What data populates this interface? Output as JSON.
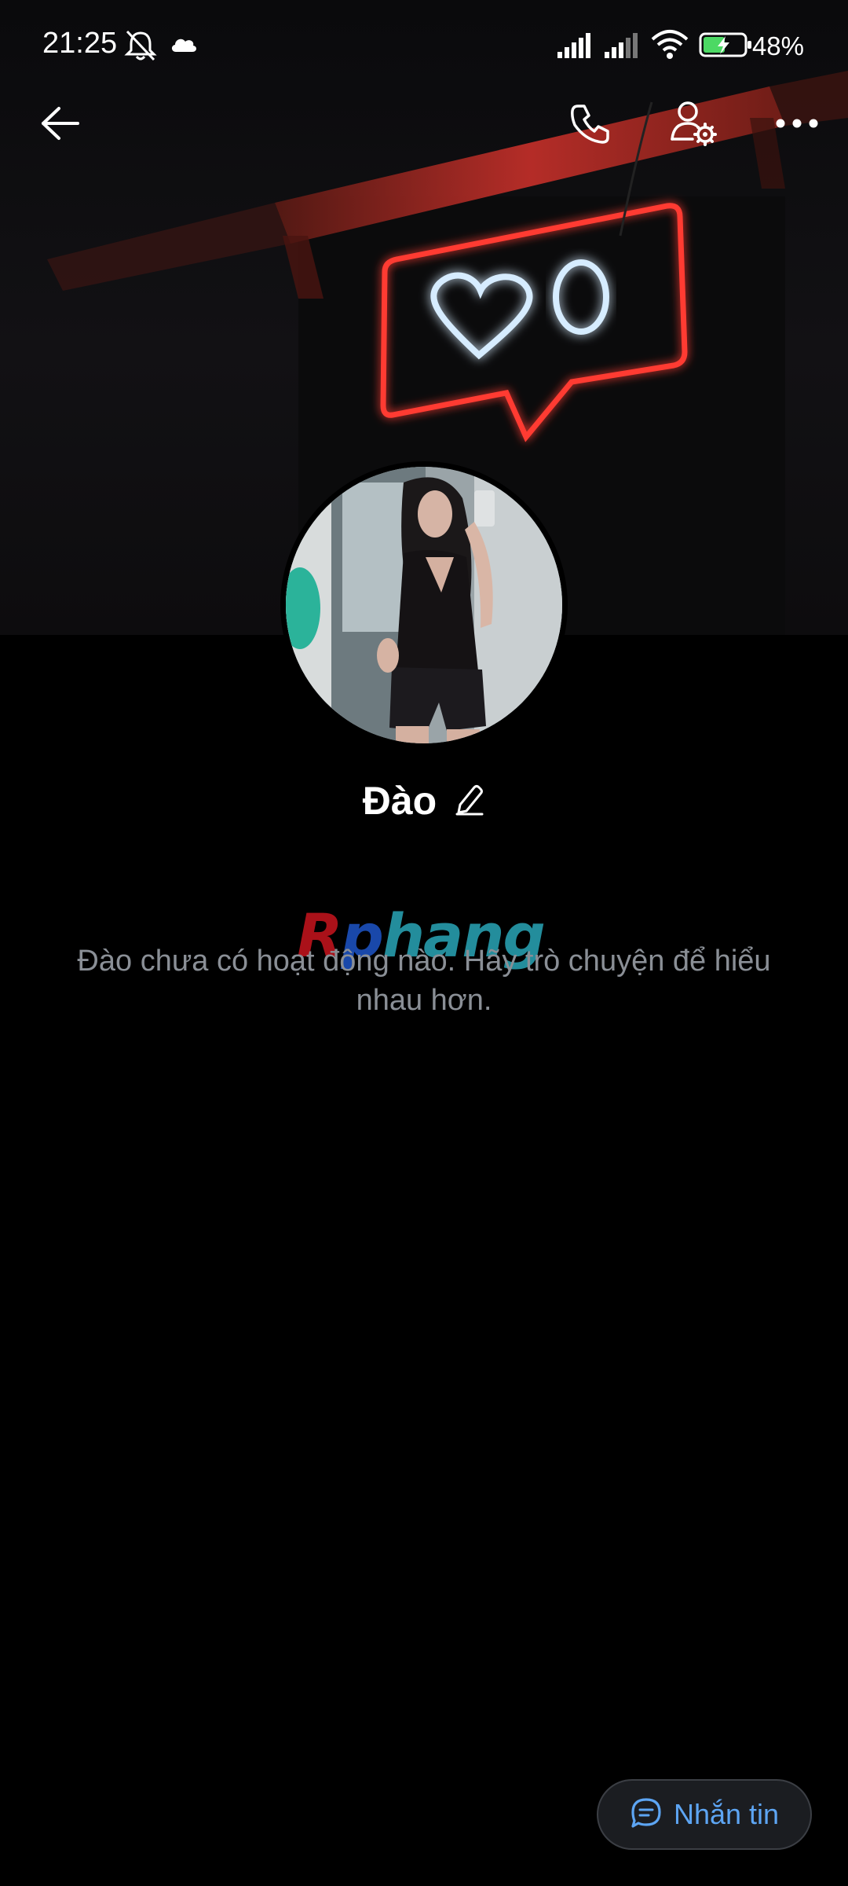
{
  "status_bar": {
    "time": "21:25",
    "battery": "48%",
    "icons": [
      "mute-notification-icon",
      "cloud-icon",
      "signal-1-icon",
      "signal-2-icon",
      "wifi-icon",
      "battery-charging-icon"
    ]
  },
  "app_bar": {
    "icons": [
      "back-arrow-icon",
      "phone-icon",
      "user-settings-icon",
      "more-icon"
    ]
  },
  "profile": {
    "name": "Đào",
    "edit_icon": "pencil-icon"
  },
  "watermark": {
    "part1": "R",
    "part2": "p",
    "part3": "hang"
  },
  "empty_state": {
    "message": "Đào chưa có hoạt động nào. Hãy trò chuyện để hiểu nhau hơn."
  },
  "fab": {
    "icon": "chat-bubble-icon",
    "label": "Nhắn tin"
  },
  "colors": {
    "accent": "#5da5f3",
    "background": "#000000",
    "muted_text": "#8a8f96",
    "neon_red": "#ff3b30",
    "neon_blue": "#cfe8ff"
  }
}
